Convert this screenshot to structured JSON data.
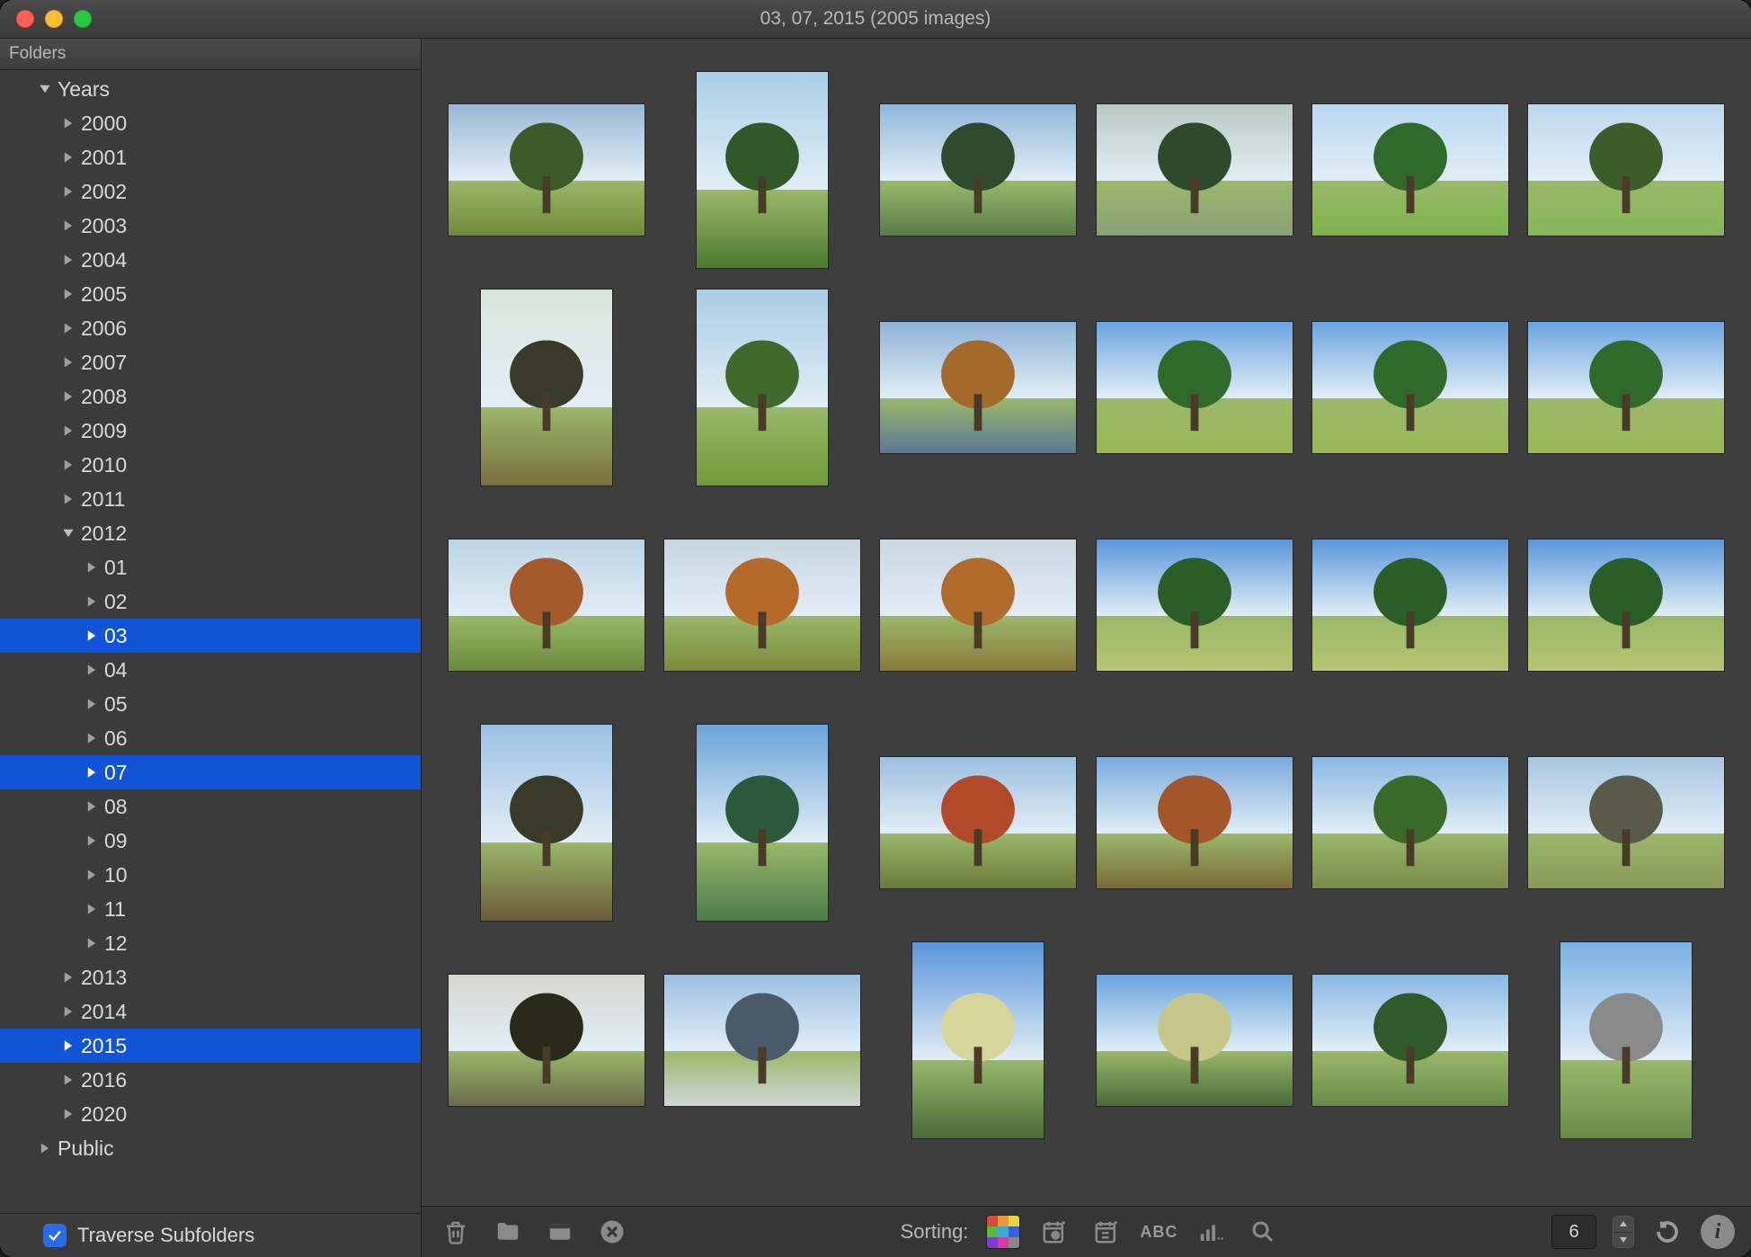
{
  "window": {
    "title": "03, 07, 2015 (2005 images)"
  },
  "sidebar": {
    "header": "Folders",
    "traverse_label": "Traverse Subfolders",
    "traverse_checked": true,
    "tree": [
      {
        "label": "Years",
        "depth": 0,
        "expanded": true,
        "selected": false
      },
      {
        "label": "2000",
        "depth": 1,
        "expanded": false,
        "selected": false
      },
      {
        "label": "2001",
        "depth": 1,
        "expanded": false,
        "selected": false
      },
      {
        "label": "2002",
        "depth": 1,
        "expanded": false,
        "selected": false
      },
      {
        "label": "2003",
        "depth": 1,
        "expanded": false,
        "selected": false
      },
      {
        "label": "2004",
        "depth": 1,
        "expanded": false,
        "selected": false
      },
      {
        "label": "2005",
        "depth": 1,
        "expanded": false,
        "selected": false
      },
      {
        "label": "2006",
        "depth": 1,
        "expanded": false,
        "selected": false
      },
      {
        "label": "2007",
        "depth": 1,
        "expanded": false,
        "selected": false
      },
      {
        "label": "2008",
        "depth": 1,
        "expanded": false,
        "selected": false
      },
      {
        "label": "2009",
        "depth": 1,
        "expanded": false,
        "selected": false
      },
      {
        "label": "2010",
        "depth": 1,
        "expanded": false,
        "selected": false
      },
      {
        "label": "2011",
        "depth": 1,
        "expanded": false,
        "selected": false
      },
      {
        "label": "2012",
        "depth": 1,
        "expanded": true,
        "selected": false
      },
      {
        "label": "01",
        "depth": 2,
        "expanded": false,
        "selected": false
      },
      {
        "label": "02",
        "depth": 2,
        "expanded": false,
        "selected": false
      },
      {
        "label": "03",
        "depth": 2,
        "expanded": false,
        "selected": true
      },
      {
        "label": "04",
        "depth": 2,
        "expanded": false,
        "selected": false
      },
      {
        "label": "05",
        "depth": 2,
        "expanded": false,
        "selected": false
      },
      {
        "label": "06",
        "depth": 2,
        "expanded": false,
        "selected": false
      },
      {
        "label": "07",
        "depth": 2,
        "expanded": false,
        "selected": true
      },
      {
        "label": "08",
        "depth": 2,
        "expanded": false,
        "selected": false
      },
      {
        "label": "09",
        "depth": 2,
        "expanded": false,
        "selected": false
      },
      {
        "label": "10",
        "depth": 2,
        "expanded": false,
        "selected": false
      },
      {
        "label": "11",
        "depth": 2,
        "expanded": false,
        "selected": false
      },
      {
        "label": "12",
        "depth": 2,
        "expanded": false,
        "selected": false
      },
      {
        "label": "2013",
        "depth": 1,
        "expanded": false,
        "selected": false
      },
      {
        "label": "2014",
        "depth": 1,
        "expanded": false,
        "selected": false
      },
      {
        "label": "2015",
        "depth": 1,
        "expanded": false,
        "selected": true
      },
      {
        "label": "2016",
        "depth": 1,
        "expanded": false,
        "selected": false
      },
      {
        "label": "2020",
        "depth": 1,
        "expanded": false,
        "selected": false
      },
      {
        "label": "Public",
        "depth": 0,
        "expanded": false,
        "selected": false
      }
    ]
  },
  "toolbar": {
    "sorting_label": "Sorting:",
    "columns_value": "6"
  },
  "thumbnails": [
    {
      "orient": "land",
      "sky": "#9bb8d6",
      "ground": "#6f8a3a",
      "accent": "#3a5a2a"
    },
    {
      "orient": "port",
      "sky": "#a9cfe8",
      "ground": "#4d7a2f",
      "accent": "#2f5a28"
    },
    {
      "orient": "land",
      "sky": "#8fb7d8",
      "ground": "#5a7c4a",
      "accent": "#2f4a2f"
    },
    {
      "orient": "land",
      "sky": "#b9c9c4",
      "ground": "#8aa079",
      "accent": "#2e4a2c"
    },
    {
      "orient": "land",
      "sky": "#b8d8f0",
      "ground": "#7cb44a",
      "accent": "#2f6a2a"
    },
    {
      "orient": "land",
      "sky": "#bcd8ee",
      "ground": "#86b65a",
      "accent": "#3a5d2a"
    },
    {
      "orient": "port",
      "sky": "#d9e6dd",
      "ground": "#7a6e3d",
      "accent": "#3a3a2a"
    },
    {
      "orient": "port",
      "sky": "#a9cce6",
      "ground": "#6f9a3a",
      "accent": "#3e6a2c"
    },
    {
      "orient": "land",
      "sky": "#8db2d6",
      "ground": "#5a7896",
      "accent": "#a46a2a"
    },
    {
      "orient": "land",
      "sky": "#6aa4e0",
      "ground": "#9ab856",
      "accent": "#2f6a2a"
    },
    {
      "orient": "land",
      "sky": "#6aa4e0",
      "ground": "#9ab856",
      "accent": "#2f6a2a"
    },
    {
      "orient": "land",
      "sky": "#6aa4e0",
      "ground": "#9ab856",
      "accent": "#2f6a2a"
    },
    {
      "orient": "land",
      "sky": "#bcd4e4",
      "ground": "#6a8a3a",
      "accent": "#a45a2a"
    },
    {
      "orient": "land",
      "sky": "#c6d6e0",
      "ground": "#7c8a3a",
      "accent": "#b66a2a"
    },
    {
      "orient": "land",
      "sky": "#c9d7e0",
      "ground": "#8a7a3a",
      "accent": "#b06a2a"
    },
    {
      "orient": "land",
      "sky": "#5a96da",
      "ground": "#b6c470",
      "accent": "#2a5e26"
    },
    {
      "orient": "land",
      "sky": "#5a96da",
      "ground": "#b6c470",
      "accent": "#2a5e26"
    },
    {
      "orient": "land",
      "sky": "#5a96da",
      "ground": "#b6c470",
      "accent": "#2a5e26"
    },
    {
      "orient": "port",
      "sky": "#9cc0e4",
      "ground": "#6a5a3a",
      "accent": "#3a3a2a"
    },
    {
      "orient": "port",
      "sky": "#6aa4da",
      "ground": "#4a7a4a",
      "accent": "#2a5a3a"
    },
    {
      "orient": "land",
      "sky": "#9cc0e0",
      "ground": "#6a7a3a",
      "accent": "#b24a2a"
    },
    {
      "orient": "land",
      "sky": "#7aaadc",
      "ground": "#7a6a3a",
      "accent": "#a4562a"
    },
    {
      "orient": "land",
      "sky": "#8ab8e2",
      "ground": "#7a8a4a",
      "accent": "#3a6a2a"
    },
    {
      "orient": "land",
      "sky": "#a8c6e2",
      "ground": "#8a9a5a",
      "accent": "#5a5a4a"
    },
    {
      "orient": "land",
      "sky": "#d6d6ce",
      "ground": "#6a6a4a",
      "accent": "#2a2a1a"
    },
    {
      "orient": "land",
      "sky": "#9cc0e2",
      "ground": "#cfd6d6",
      "accent": "#4a5a6a"
    },
    {
      "orient": "port",
      "sky": "#5a96da",
      "ground": "#4a6a3a",
      "accent": "#d6d69a"
    },
    {
      "orient": "land",
      "sky": "#6aa4de",
      "ground": "#4a6a3a",
      "accent": "#c6c68a"
    },
    {
      "orient": "land",
      "sky": "#8ab8e4",
      "ground": "#6a8a4a",
      "accent": "#2f5a2a"
    },
    {
      "orient": "port",
      "sky": "#7ab0e4",
      "ground": "#6a8a4a",
      "accent": "#8a8a8a"
    }
  ]
}
